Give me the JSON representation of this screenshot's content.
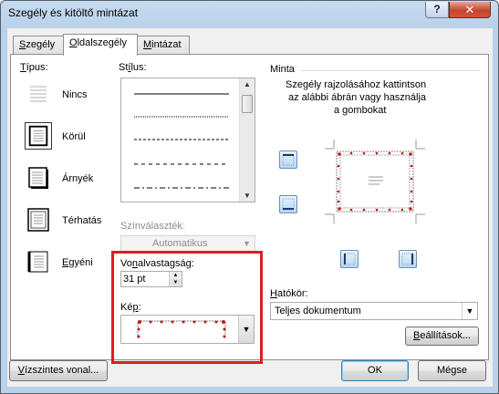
{
  "window": {
    "title": "Szegély és kitöltő mintázat",
    "help": "?",
    "close": "✕"
  },
  "tabs": [
    {
      "pre": "",
      "u": "S",
      "post": "zegély"
    },
    {
      "pre": "",
      "u": "O",
      "post": "ldalszegély"
    },
    {
      "pre": "",
      "u": "M",
      "post": "intázat"
    }
  ],
  "type_section": {
    "label_u": "T",
    "label_rest": "ípus:",
    "items": [
      {
        "u": "",
        "rest": "Nincs"
      },
      {
        "u": "",
        "rest": "Körül"
      },
      {
        "u": "",
        "rest": "Árnyék"
      },
      {
        "u": "",
        "rest": "Térhatás"
      },
      {
        "u": "E",
        "rest": "gyéni"
      }
    ],
    "selected": "Körül"
  },
  "style_section": {
    "label_pre": "St",
    "label_u": "í",
    "label_post": "lus:"
  },
  "color_section": {
    "label": "Színválasztékː",
    "value": "Automatikus"
  },
  "width_section": {
    "label_pre": "Vo",
    "label_u": "n",
    "label_post": "alvastagság:",
    "value": "31 pt"
  },
  "art_section": {
    "label_pre": "Ké",
    "label_u": "p",
    "label_post": ":"
  },
  "preview": {
    "title": "Minta",
    "hint": [
      "Szegély rajzolásához kattintson",
      "az alábbi ábrán vagy használja",
      "a gombokat"
    ]
  },
  "apply_to": {
    "label_pre": "",
    "label_u": "H",
    "label_post": "atókör:",
    "value": "Teljes dokumentum"
  },
  "buttons": {
    "options": {
      "pre": "",
      "u": "B",
      "post": "eállítások..."
    },
    "horizontal_line": {
      "pre": "",
      "u": "V",
      "post": "ízszintes vonal..."
    },
    "ok": "OK",
    "cancel": "Mégse"
  },
  "colors": {
    "highlight": "#e11b22",
    "art_red": "#c4161c"
  }
}
